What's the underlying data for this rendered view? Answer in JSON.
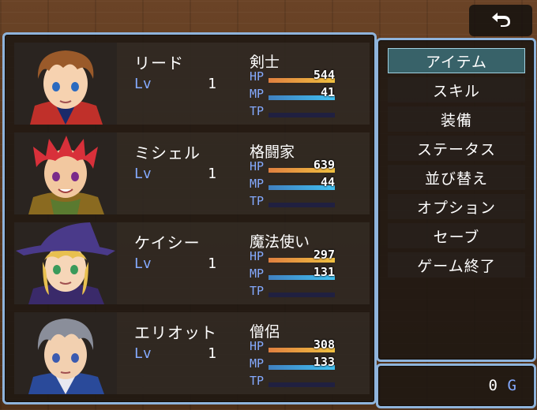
{
  "back_button": {
    "icon": "return-arrow-icon"
  },
  "actors": [
    {
      "name": "リード",
      "class": "剣士",
      "level_label": "Lv",
      "level": "1",
      "hp_label": "HP",
      "hp": "544",
      "mp_label": "MP",
      "mp": "41",
      "tp_label": "TP",
      "tp_fill": 0,
      "hp_fill": 1.0,
      "mp_fill": 1.0,
      "hair_color": "#9a5a2a",
      "accent_color": "#c0302a"
    },
    {
      "name": "ミシェル",
      "class": "格闘家",
      "level_label": "Lv",
      "level": "1",
      "hp_label": "HP",
      "hp": "639",
      "mp_label": "MP",
      "mp": "44",
      "tp_label": "TP",
      "tp_fill": 0,
      "hp_fill": 1.0,
      "mp_fill": 1.0,
      "hair_color": "#d8303a",
      "accent_color": "#8a6a20"
    },
    {
      "name": "ケイシー",
      "class": "魔法使い",
      "level_label": "Lv",
      "level": "1",
      "hp_label": "HP",
      "hp": "297",
      "mp_label": "MP",
      "mp": "131",
      "tp_label": "TP",
      "tp_fill": 0,
      "hp_fill": 1.0,
      "mp_fill": 1.0,
      "hair_color": "#e8c050",
      "accent_color": "#3a2a6a"
    },
    {
      "name": "エリオット",
      "class": "僧侶",
      "level_label": "Lv",
      "level": "1",
      "hp_label": "HP",
      "hp": "308",
      "mp_label": "MP",
      "mp": "133",
      "tp_label": "TP",
      "tp_fill": 0,
      "hp_fill": 1.0,
      "mp_fill": 1.0,
      "hair_color": "#8a8e9a",
      "accent_color": "#2a4a9a"
    }
  ],
  "commands": [
    {
      "label": "アイテム",
      "selected": true
    },
    {
      "label": "スキル",
      "selected": false
    },
    {
      "label": "装備",
      "selected": false
    },
    {
      "label": "ステータス",
      "selected": false
    },
    {
      "label": "並び替え",
      "selected": false
    },
    {
      "label": "オプション",
      "selected": false
    },
    {
      "label": "セーブ",
      "selected": false
    },
    {
      "label": "ゲーム終了",
      "selected": false
    }
  ],
  "gold": {
    "value": "0",
    "unit": "G"
  },
  "colors": {
    "window_border": "#8fb4dc",
    "system_blue": "#84aaff",
    "hp": "#f0c040",
    "mp": "#40c0f0"
  }
}
